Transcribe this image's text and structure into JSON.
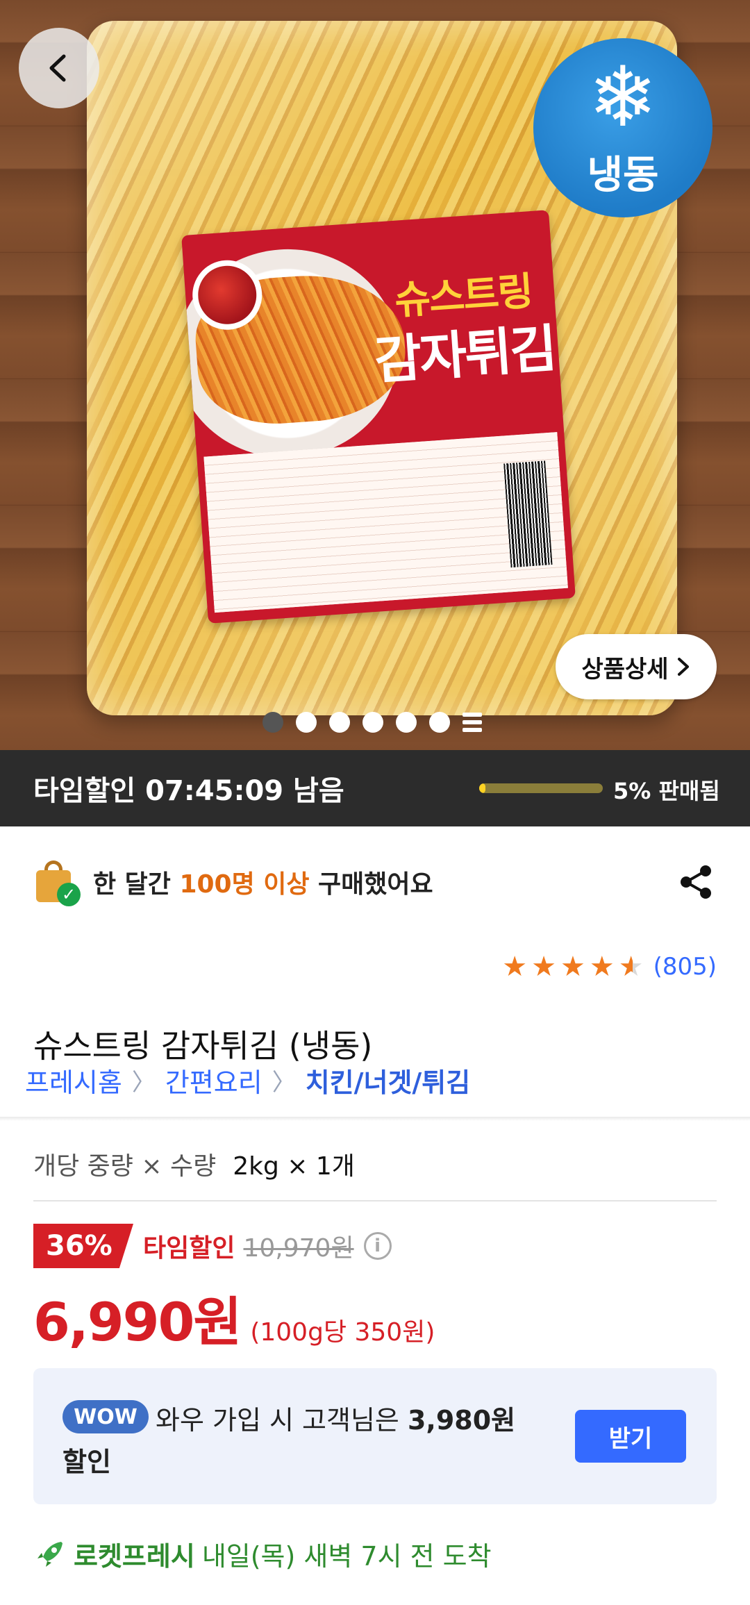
{
  "hero": {
    "label_title_1": "슈스트링",
    "label_title_2": "감자튀김",
    "frozen_badge": "냉동",
    "detail_button": "상품상세",
    "image_dots_count": 6,
    "active_dot_index": 0
  },
  "time_sale": {
    "text": "타임할인 07:45:09 남음",
    "sold_text": "5% 판매됨",
    "sold_fraction": 0.05
  },
  "social_proof": {
    "prefix": "한 달간 ",
    "highlight": "100명 이상",
    "suffix": " 구매했어요"
  },
  "rating": {
    "stars": 4.5,
    "count": "(805)"
  },
  "product": {
    "title": "슈스트링 감자튀김 (냉동)"
  },
  "breadcrumb": [
    "프레시홈",
    "간편요리",
    "치킨/너겟/튀김"
  ],
  "option": {
    "label": "개당 중량 × 수량",
    "value": "2kg × 1개"
  },
  "price": {
    "discount": "36%",
    "time_label": "타임할인",
    "original": "10,970원",
    "sale": "6,990원",
    "unit": "(100g당 350원)"
  },
  "wow": {
    "badge": "WOW",
    "line1_prefix": "와우 가입 시 고객님은 ",
    "line1_amount": "3,980원",
    "line2": "할인",
    "button": "받기"
  },
  "delivery": {
    "brand": "로켓프레시",
    "rest": " 내일(목) 새벽 7시 전  도착"
  },
  "colors": {
    "accent_red": "#d61f26",
    "link_blue": "#346aff",
    "rocket_green": "#2e8b2e",
    "highlight_orange": "#e06a10"
  }
}
